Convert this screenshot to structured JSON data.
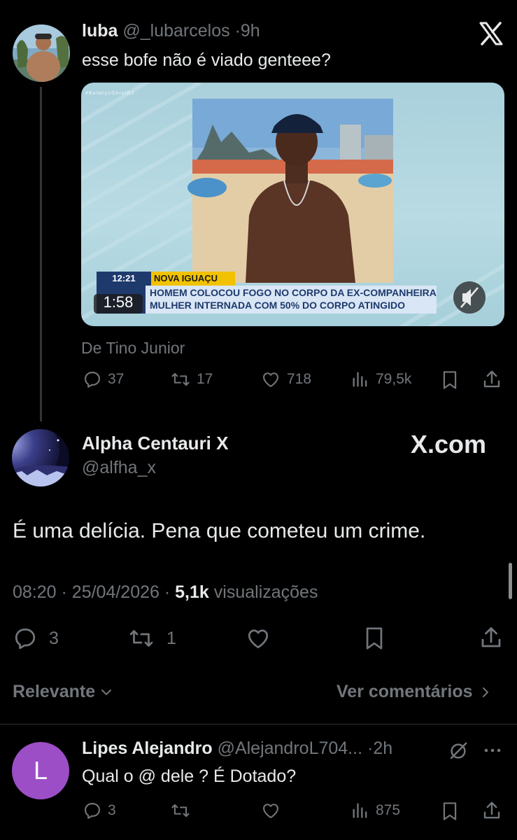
{
  "quoted": {
    "display_name": "luba",
    "handle": "@_lubarcelos",
    "separator": "·",
    "time": "9h",
    "text": "esse bofe não é viado genteee?",
    "media": {
      "watermark": "#BalançoGeralRJ",
      "clock": "12:21",
      "location": "NOVA IGUAÇU",
      "headline_line1": "HOMEM COLOCOU FOGO NO CORPO DA EX-COMPANHEIRA",
      "headline_line2": "MULHER INTERNADA COM 50% DO CORPO ATINGIDO",
      "duration": "1:58",
      "mute_icon": "speaker-muted-icon"
    },
    "source": "De Tino Junior",
    "actions": {
      "replies": "37",
      "reposts": "17",
      "likes": "718",
      "views": "79,5k"
    }
  },
  "main": {
    "display_name": "Alpha Centauri X",
    "handle": "@alfha_x",
    "brand": "X.com",
    "text": "É uma delícia. Pena que cometeu um crime.",
    "time": "08:20",
    "sep1": "·",
    "date": "25/04/2026",
    "sep2": "·",
    "views_count": "5,1k",
    "views_label": "visualizações",
    "actions": {
      "replies": "3",
      "reposts": "1"
    }
  },
  "sort": {
    "label": "Relevante",
    "see_comments": "Ver comentários"
  },
  "reply": {
    "avatar_letter": "L",
    "display_name": "Lipes Alejandro",
    "handle": "@AlejandroL704...",
    "separator": "·",
    "time": "2h",
    "text": "Qual o @ dele ? É Dotado?",
    "actions": {
      "replies": "3",
      "views": "875"
    }
  },
  "colors": {
    "background": "#000000",
    "text_primary": "#e7e9ea",
    "text_secondary": "#71767b",
    "divider": "#2f3336",
    "reply_avatar": "#9c4ec7"
  }
}
